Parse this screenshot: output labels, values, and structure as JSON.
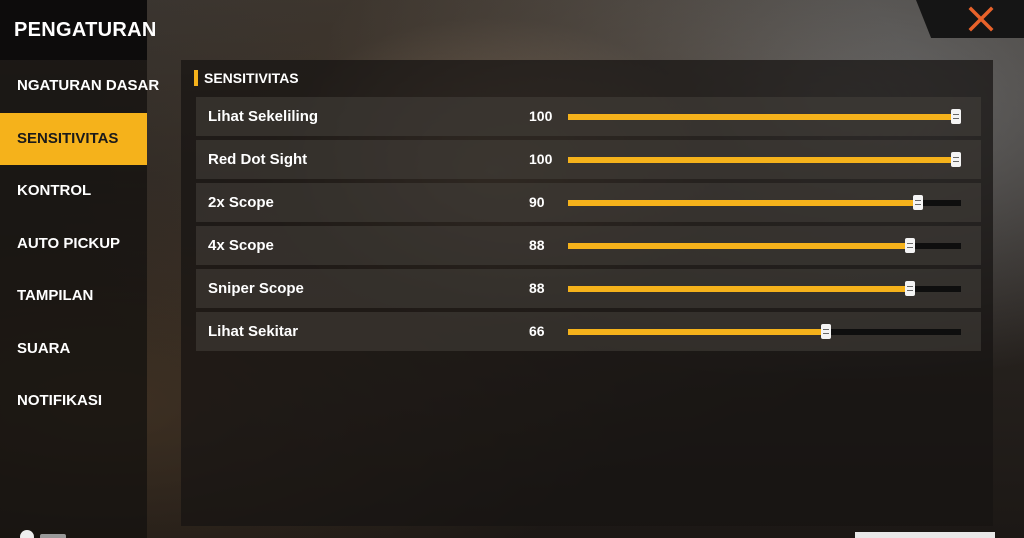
{
  "sidebar": {
    "title": "PENGATURAN",
    "items": [
      {
        "label": "NGATURAN DASAR",
        "active": false
      },
      {
        "label": "SENSITIVITAS",
        "active": true
      },
      {
        "label": "KONTROL",
        "active": false
      },
      {
        "label": "AUTO PICKUP",
        "active": false
      },
      {
        "label": "TAMPILAN",
        "active": false
      },
      {
        "label": "SUARA",
        "active": false
      },
      {
        "label": "NOTIFIKASI",
        "active": false
      }
    ]
  },
  "close_icon": "close-icon",
  "panel": {
    "section_title": "SENSITIVITAS",
    "max_value": 100,
    "sliders": [
      {
        "label": "Lihat Sekeliling",
        "value": 100
      },
      {
        "label": "Red Dot Sight",
        "value": 100
      },
      {
        "label": "2x Scope",
        "value": 90
      },
      {
        "label": "4x Scope",
        "value": 88
      },
      {
        "label": "Sniper Scope",
        "value": 88
      },
      {
        "label": "Lihat Sekitar",
        "value": 66
      }
    ]
  },
  "colors": {
    "accent": "#f5b21b",
    "close": "#e8622a"
  }
}
